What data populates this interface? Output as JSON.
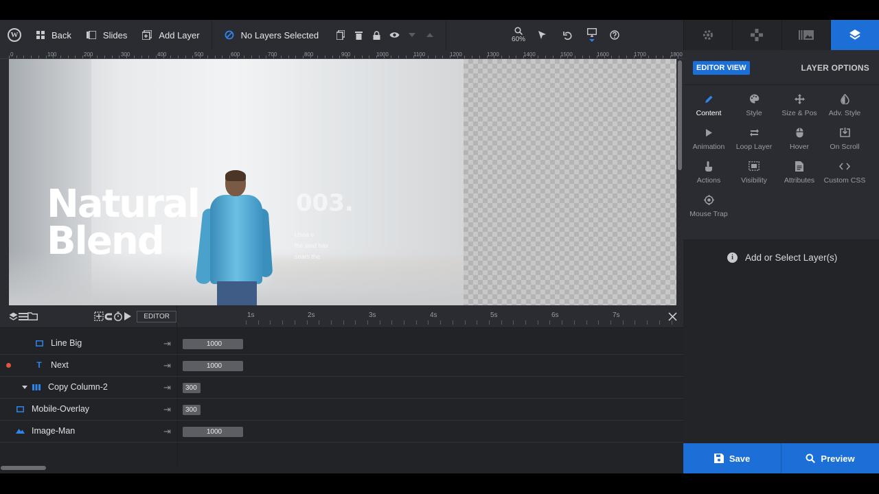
{
  "toolbar": {
    "back_label": "Back",
    "slides_label": "Slides",
    "add_layer_label": "Add Layer",
    "selection_status": "No Layers Selected",
    "zoom_level": "60%"
  },
  "ruler": {
    "marks": [
      "0",
      "100",
      "200",
      "300",
      "400",
      "500",
      "600",
      "700",
      "800",
      "900",
      "1000",
      "1100",
      "1200",
      "1300",
      "1400",
      "1500",
      "1600",
      "1700",
      "1800"
    ]
  },
  "slide": {
    "headline_line1": "Natural",
    "headline_line2": "Blend",
    "number": "003.",
    "text_line1": "Usea e",
    "text_line2": "the land hav",
    "text_line3": "sears the"
  },
  "timeline": {
    "editor_tag": "EDITOR",
    "scale": [
      "1s",
      "2s",
      "3s",
      "4s",
      "5s",
      "6s",
      "7s"
    ],
    "rows": [
      {
        "name": "Line Big",
        "icon": "rect-outline-icon",
        "duration": "1000"
      },
      {
        "name": "Next",
        "icon": "text-t-icon",
        "duration": "1000"
      },
      {
        "name": "Copy Column-2",
        "icon": "column-icon",
        "duration": "300"
      },
      {
        "name": "Mobile-Overlay",
        "icon": "rect-outline-icon",
        "duration": "300"
      },
      {
        "name": "Image-Man",
        "icon": "image-icon",
        "duration": "1000"
      }
    ]
  },
  "panel": {
    "editor_view": "EDITOR VIEW",
    "layer_options": "LAYER OPTIONS",
    "options": [
      {
        "label": "Content",
        "icon": "pencil-icon",
        "active": true
      },
      {
        "label": "Style",
        "icon": "palette-icon"
      },
      {
        "label": "Size & Pos",
        "icon": "move-icon"
      },
      {
        "label": "Adv. Style",
        "icon": "contrast-icon"
      },
      {
        "label": "Animation",
        "icon": "play-icon"
      },
      {
        "label": "Loop Layer",
        "icon": "loop-icon"
      },
      {
        "label": "Hover",
        "icon": "mouse-icon"
      },
      {
        "label": "On Scroll",
        "icon": "scroll-down-icon"
      },
      {
        "label": "Actions",
        "icon": "hand-pointer-icon"
      },
      {
        "label": "Visibility",
        "icon": "visibility-icon"
      },
      {
        "label": "Attributes",
        "icon": "document-icon"
      },
      {
        "label": "Custom CSS",
        "icon": "code-icon"
      },
      {
        "label": "Mouse Trap",
        "icon": "target-icon"
      }
    ],
    "empty_message": "Add or Select Layer(s)",
    "save_label": "Save",
    "preview_label": "Preview"
  },
  "colors": {
    "accent": "#1b6fd6",
    "panel_bg": "#2b2c31",
    "timeline_bg": "#222327"
  }
}
